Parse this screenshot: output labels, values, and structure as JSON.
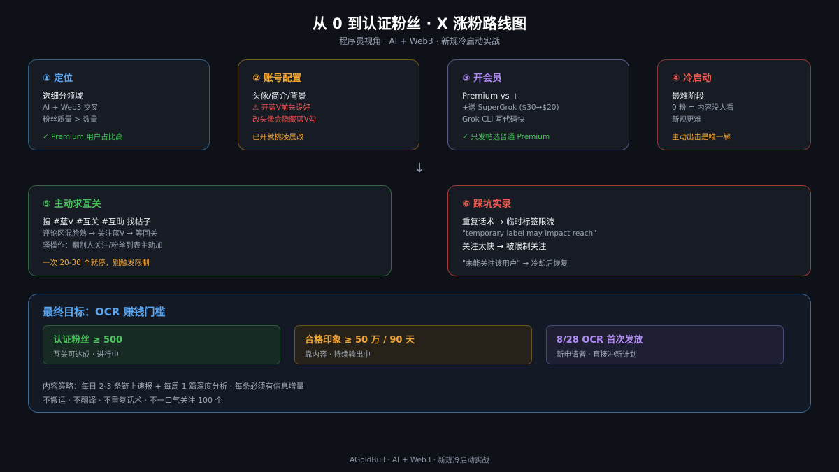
{
  "header": {
    "title": "从 0 到认证粉丝 · X 涨粉路线图",
    "subtitle": "程序员视角 · AI + Web3 · 新规冷启动实战"
  },
  "steps": [
    {
      "title": "① 定位",
      "main": "选细分领域",
      "lines": [
        "AI + Web3 交叉",
        "粉丝质量 > 数量"
      ],
      "note": "✓ Premium 用户占比高"
    },
    {
      "title": "② 账号配置",
      "main": "头像/简介/背景",
      "warnings": [
        "⚠ 开蓝V前先设好",
        "改头像会隐藏蓝V勾"
      ],
      "note": "已开就挑凌晨改"
    },
    {
      "title": "③ 开会员",
      "main": "Premium vs +",
      "lines": [
        "+送 SuperGrok ($30→$20)",
        "Grok CLI 写代码快"
      ],
      "note": "✓ 只发帖选普通 Premium"
    },
    {
      "title": "④ 冷启动",
      "main": "最难阶段",
      "lines": [
        "0 粉 = 内容没人看",
        "新规更难"
      ],
      "note": "主动出击是唯一解"
    },
    {
      "title": "⑤ 主动求互关",
      "main": "搜 #蓝V #互关 #互助 找帖子",
      "lines": [
        "评论区混脸熟 → 关注蓝V → 等回关",
        "骚操作：翻别人关注/粉丝列表主动加"
      ],
      "note": "一次 20-30 个就停，别触发限制"
    },
    {
      "title": "⑥ 踩坑实录",
      "main": "重复话术 → 临时标签限流",
      "quote": "\"temporary label may impact reach\"",
      "main2": "关注太快 → 被限制关注",
      "note": "\"未能关注该用户\" → 冷却后恢复"
    }
  ],
  "arrow": "↓",
  "goal": {
    "title": "最终目标：OCR 赚钱门槛",
    "metrics": [
      {
        "title": "认证粉丝 ≥ 500",
        "sub": "互关可达成 · 进行中"
      },
      {
        "title": "合格印象 ≥ 50 万 / 90 天",
        "sub": "靠内容 · 持续输出中"
      },
      {
        "title": "8/28 OCR 首次发放",
        "sub": "新申请者 · 直接冲新计划"
      }
    ],
    "strategy": [
      "内容策略：每日 2-3 条链上速报 + 每周 1 篇深度分析 · 每条必须有信息增量",
      "不搬运 · 不翻译 · 不重复话术 · 不一口气关注 100 个"
    ]
  },
  "footer": "AGoldBull · AI + Web3 · 新规冷启动实战",
  "colors": {
    "background": "#0e1118",
    "blue": "#5aa8f5",
    "orange": "#f2a536",
    "purple": "#b28cf7",
    "red": "#f05a4f",
    "green": "#49c35b"
  }
}
